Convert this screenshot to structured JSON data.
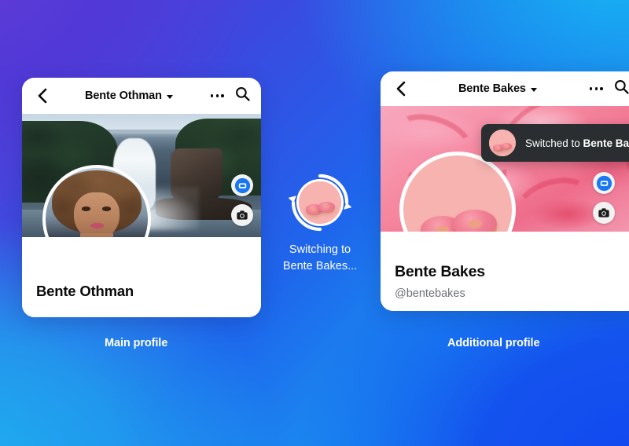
{
  "background": {
    "color_top_left": "#5B3FD6",
    "color_top_right": "#19B0F2",
    "color_bottom_left": "#1FAFF0",
    "color_bottom_right": "#1145F0"
  },
  "main_profile_card": {
    "header": {
      "back_icon": "chevron-left-icon",
      "title": "Bente Othman",
      "caret_icon": "caret-down-icon",
      "overflow_icon": "more-horizontal-icon",
      "search_icon": "search-icon"
    },
    "cover": {
      "image_description": "waterfall-cover-photo",
      "messenger_icon": "messenger-bubble-icon",
      "cover_camera_icon": "camera-icon"
    },
    "avatar": {
      "image_description": "woman-portrait-avatar",
      "camera_icon": "camera-icon"
    },
    "name": "Bente Othman",
    "handle": ""
  },
  "additional_profile_card": {
    "header": {
      "back_icon": "chevron-left-icon",
      "title": "Bente Bakes",
      "caret_icon": "caret-down-icon",
      "overflow_icon": "more-horizontal-icon",
      "search_icon": "search-icon"
    },
    "cover": {
      "image_description": "pink-frosting-cover-photo",
      "messenger_icon": "messenger-bubble-icon",
      "cover_camera_icon": "camera-icon"
    },
    "avatar": {
      "image_description": "pink-donuts-avatar",
      "camera_icon": "camera-icon"
    },
    "name": "Bente Bakes",
    "handle": "@bentebakes"
  },
  "toast": {
    "avatar_description": "pink-donuts-avatar",
    "prefix": "Switched to ",
    "profile_name": "Bente Bak",
    "background_color": "#2b2e30"
  },
  "switcher": {
    "icon": "refresh-sync-icon",
    "avatar_description": "pink-donuts-avatar",
    "line1": "Switching to",
    "line2": "Bente Bakes..."
  },
  "captions": {
    "main": "Main profile",
    "additional": "Additional profile"
  }
}
